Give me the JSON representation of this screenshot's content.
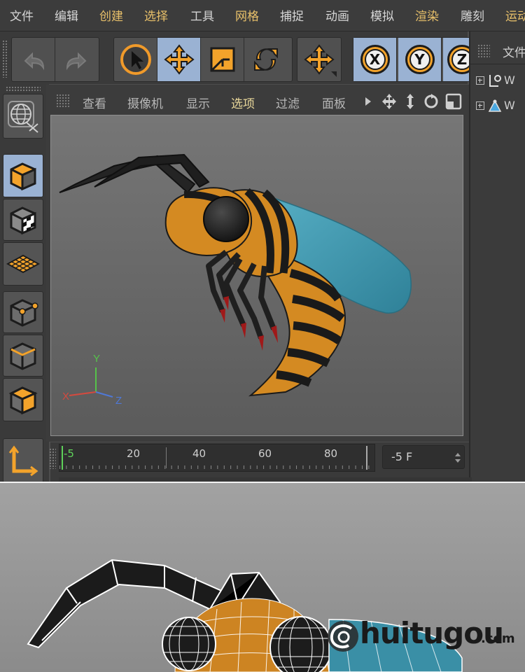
{
  "menubar": {
    "items": [
      {
        "label": "文件",
        "highlight": false
      },
      {
        "label": "编辑",
        "highlight": false
      },
      {
        "label": "创建",
        "highlight": true
      },
      {
        "label": "选择",
        "highlight": true
      },
      {
        "label": "工具",
        "highlight": false
      },
      {
        "label": "网格",
        "highlight": true
      },
      {
        "label": "捕捉",
        "highlight": false
      },
      {
        "label": "动画",
        "highlight": false
      },
      {
        "label": "模拟",
        "highlight": false
      },
      {
        "label": "渲染",
        "highlight": true
      },
      {
        "label": "雕刻",
        "highlight": false
      },
      {
        "label": "运动",
        "highlight": true
      }
    ]
  },
  "toolbar": {
    "undo_icon": "undo-icon",
    "redo_icon": "redo-icon",
    "tools": [
      "select-arrow-icon",
      "move-icon",
      "scale-icon",
      "rotate-icon"
    ],
    "active_tool": "move-icon",
    "axis_labels": [
      "X",
      "Y",
      "Z"
    ]
  },
  "viewport": {
    "menu": [
      {
        "label": "查看",
        "highlight": false
      },
      {
        "label": "摄像机",
        "highlight": false
      },
      {
        "label": "显示",
        "highlight": false
      },
      {
        "label": "选项",
        "highlight": true
      },
      {
        "label": "过滤",
        "highlight": false
      },
      {
        "label": "面板",
        "highlight": false
      }
    ],
    "axis": {
      "x": "X",
      "y": "Y",
      "z": "Z"
    }
  },
  "object_manager": {
    "menu_label": "文件",
    "items": [
      {
        "label": "W",
        "icon": "null-object-icon"
      },
      {
        "label": "W",
        "icon": "bone-object-icon"
      }
    ]
  },
  "timeline": {
    "ticks": [
      "-5",
      "20",
      "40",
      "60",
      "80"
    ],
    "current_frame": "-5 F"
  },
  "watermark": {
    "brand": "huitugou",
    "suffix": ".com"
  },
  "colors": {
    "accent": "#f09a2a",
    "active": "#9ab2d3",
    "bee_body": "#d48a22",
    "bee_wing": "#3b93ab"
  }
}
